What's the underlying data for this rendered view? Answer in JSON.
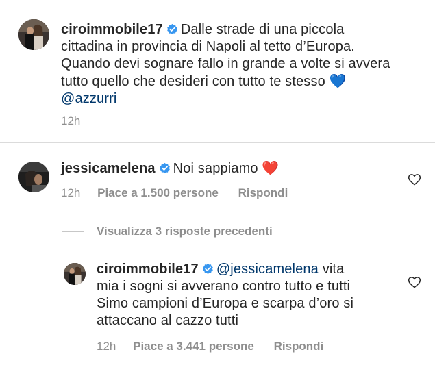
{
  "post": {
    "username": "ciroimmobile17",
    "caption_lines": [
      "Dalle strade di una piccola",
      "cittadina in provincia di Napoli al tetto d’Europa.",
      "Quando devi sognare fallo in grande a volte si avvera",
      "tutto quello che desideri con tutto te stesso"
    ],
    "heart_emoji_blue": "💙",
    "mention": "@azzurri",
    "time": "12h"
  },
  "comment": {
    "username": "jessicamelena",
    "text": "Noi sappiamo",
    "heart_emoji_red": "❤️",
    "time": "12h",
    "likes": "Piace a 1.500 persone",
    "reply": "Rispondi"
  },
  "view_replies": "Visualizza 3 risposte precedenti",
  "reply": {
    "username": "ciroimmobile17",
    "mention": "@jessicamelena",
    "text_first": "vita",
    "text_lines": [
      "mia i sogni si avverano contro tutto e tutti",
      "Simo campioni d’Europa e scarpa d’oro si",
      "attaccano al cazzo tutti"
    ],
    "time": "12h",
    "likes": "Piace a 3.441 persone",
    "reply": "Rispondi"
  },
  "colors": {
    "verified": "#3897f0",
    "mention": "#00376b",
    "meta": "#8e8e8e",
    "divider": "#dbdbdb"
  },
  "icons": {
    "verified": "verified-badge-icon",
    "like": "heart-outline-icon"
  }
}
